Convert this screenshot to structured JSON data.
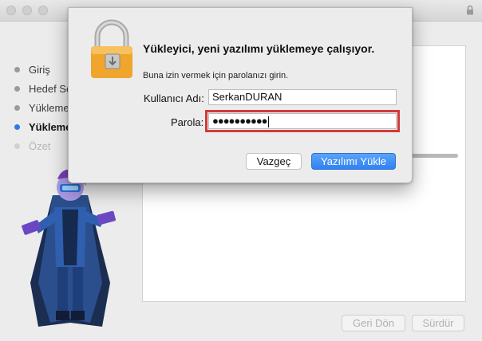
{
  "installer": {
    "steps": [
      {
        "label": "Giriş",
        "state": "done"
      },
      {
        "label": "Hedef Se",
        "state": "done"
      },
      {
        "label": "Yükleme",
        "state": "done"
      },
      {
        "label": "Yükleme",
        "state": "active"
      },
      {
        "label": "Özet",
        "state": "pending"
      }
    ],
    "back_label": "Geri Dön",
    "continue_label": "Sürdür"
  },
  "dialog": {
    "title": "Yükleyici, yeni yazılımı yüklemeye çalışıyor.",
    "subtitle": "Buna izin vermek için parolanızı girin.",
    "username_label": "Kullanıcı Adı:",
    "username_value": "SerkanDURAN",
    "password_label": "Parola:",
    "password_masked": "●●●●●●●●●●",
    "cancel_label": "Vazgeç",
    "install_label": "Yazılımı Yükle"
  },
  "colors": {
    "accent": "#2f82f4",
    "highlight_border": "#d23a3a",
    "active_step_dot": "#2c7be5"
  },
  "icons": {
    "lock": "padlock-icon",
    "mascot": "mascot-character"
  }
}
